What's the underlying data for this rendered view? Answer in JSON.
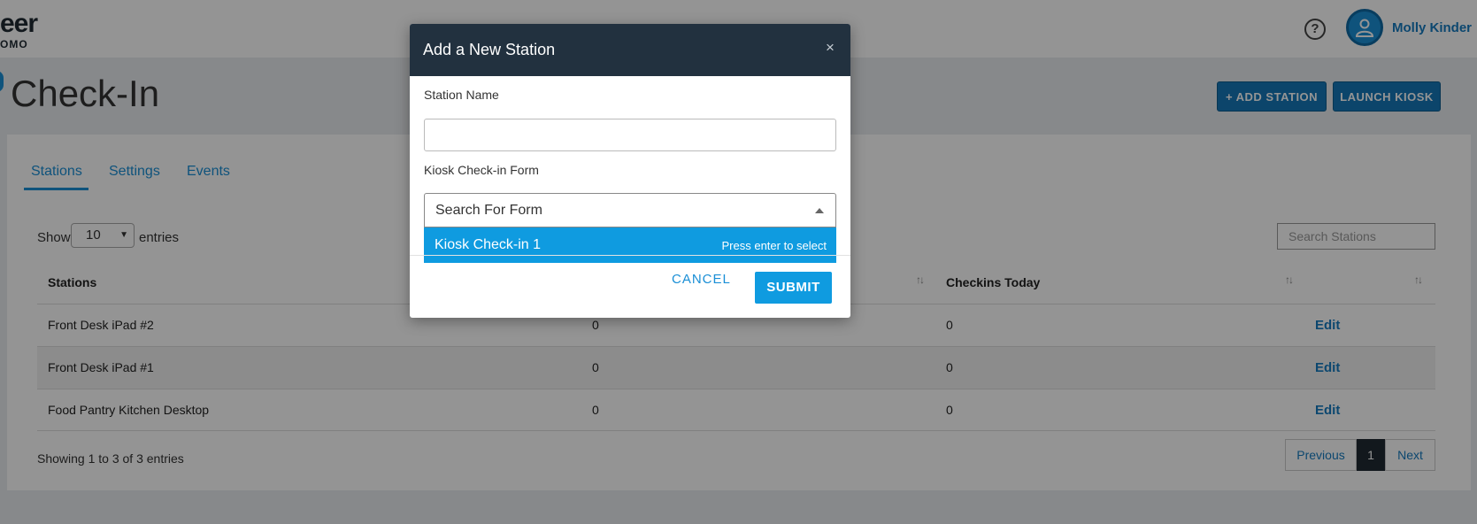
{
  "header": {
    "logo_main": "eer",
    "logo_sub": "OMO",
    "help_symbol": "?",
    "user_name": "Molly Kinder"
  },
  "page": {
    "title": "Check-In",
    "add_station_label": "+ ADD STATION",
    "launch_kiosk_label": "LAUNCH KIOSK"
  },
  "tabs": [
    {
      "label": "Stations",
      "active": true
    },
    {
      "label": "Settings",
      "active": false
    },
    {
      "label": "Events",
      "active": false
    }
  ],
  "table": {
    "show_label": "Show",
    "entries_value": "10",
    "entries_label": "entries",
    "search_placeholder": "Search Stations",
    "columns": [
      "Stations",
      "",
      "Checkins Today",
      ""
    ],
    "rows": [
      {
        "station": "Front Desk iPad #2",
        "col2": "0",
        "checkins_today": "0",
        "action": "Edit"
      },
      {
        "station": "Front Desk iPad #1",
        "col2": "0",
        "checkins_today": "0",
        "action": "Edit"
      },
      {
        "station": "Food Pantry Kitchen Desktop",
        "col2": "0",
        "checkins_today": "0",
        "action": "Edit"
      }
    ],
    "showing_text": "Showing 1 to 3 of 3 entries",
    "pagination": {
      "previous": "Previous",
      "current": "1",
      "next": "Next"
    }
  },
  "modal": {
    "title": "Add a New Station",
    "close_symbol": "×",
    "station_name_label": "Station Name",
    "station_name_value": "",
    "form_label": "Kiosk Check-in Form",
    "form_search_placeholder": "Search For Form",
    "option_label": "Kiosk Check-in 1",
    "option_hint": "Press enter to select",
    "cancel_label": "CANCEL",
    "submit_label": "SUBMIT"
  },
  "colors": {
    "accent": "#1a8fd6",
    "header_dark": "#22313f",
    "option_highlight": "#0f9be0"
  }
}
